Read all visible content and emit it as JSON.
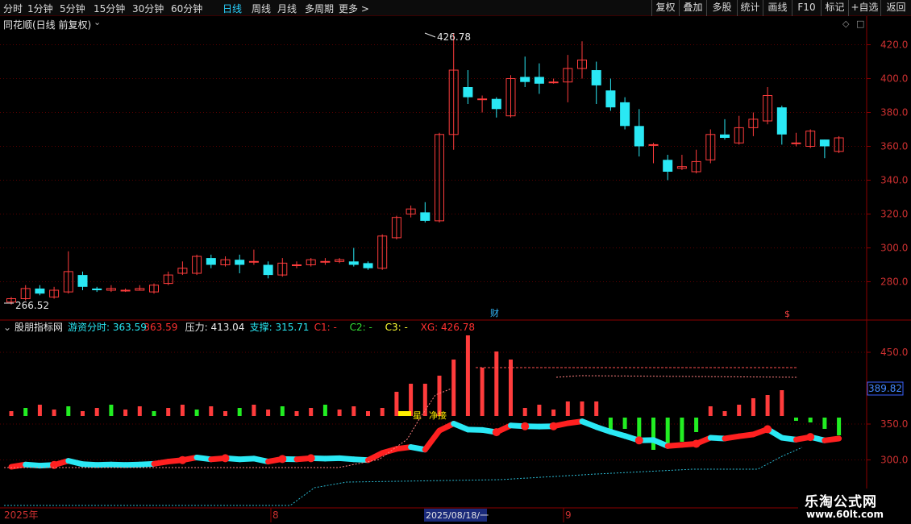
{
  "toolbar": {
    "periods": [
      "分时",
      "1分钟",
      "5分钟",
      "15分钟",
      "30分钟",
      "60分钟",
      "日线",
      "周线",
      "月线",
      "多周期",
      "更多 >"
    ],
    "active_period": "日线",
    "right_buttons": [
      "复权",
      "叠加",
      "多股",
      "统计",
      "画线",
      "F10",
      "标记",
      "+自选",
      "返回"
    ]
  },
  "main_chart": {
    "title": "同花顺(日线 前复权)",
    "y_ticks": [
      "420.0",
      "400.0",
      "380.0",
      "360.0",
      "340.0",
      "320.0",
      "300.0",
      "280.0"
    ],
    "high_label": "426.78",
    "low_label": "266.52",
    "event_marker_cai": "财",
    "event_marker_s": "$"
  },
  "indicator": {
    "name": "股朋指标网",
    "items": [
      {
        "label": "游资分时: 363.59",
        "color": "#2ae8f4"
      },
      {
        "label": "363.59",
        "color": "#ff3030"
      },
      {
        "label": "压力: 413.04",
        "color": "#e8e8e8"
      },
      {
        "label": "支撑: 315.71",
        "color": "#2ae8f4"
      },
      {
        "label": "C1: -",
        "color": "#ff3030"
      },
      {
        "label": "C2: -",
        "color": "#33dd33"
      },
      {
        "label": "C3: -",
        "color": "#ffff33"
      },
      {
        "label": "XG: 426.78",
        "color": "#ff3030"
      }
    ],
    "y_ticks": [
      "450.0",
      "350.0",
      "300.0"
    ],
    "price_box": "389.82",
    "annotation": "净接"
  },
  "timeline": {
    "labels": [
      "2025年",
      "8",
      "2025/08/18/一",
      "9"
    ]
  },
  "watermark": {
    "line1": "乐淘公式网",
    "line2": "www.60lt.com"
  },
  "colors": {
    "up": "#ff3c3c",
    "down": "#2ae8f4",
    "grid": "#5a0000",
    "axis": "#8b0000"
  },
  "chart_data": {
    "type": "candlestick",
    "candles": [
      [
        268,
        270,
        266.52,
        271
      ],
      [
        270,
        276,
        269,
        278
      ],
      [
        276,
        273,
        272,
        278
      ],
      [
        271,
        275,
        270,
        277
      ],
      [
        274,
        286,
        273,
        298
      ],
      [
        284,
        277,
        275,
        286
      ],
      [
        276,
        275,
        274,
        277
      ],
      [
        275,
        276,
        274,
        278
      ],
      [
        275,
        275,
        274,
        276
      ],
      [
        275,
        276,
        275,
        278
      ],
      [
        274,
        278,
        273,
        279
      ],
      [
        279,
        284,
        278,
        286
      ],
      [
        285,
        288,
        284,
        292
      ],
      [
        285,
        295,
        284,
        296
      ],
      [
        294,
        290,
        288,
        296
      ],
      [
        290,
        293,
        289,
        295
      ],
      [
        293,
        290,
        285,
        296
      ],
      [
        292,
        292,
        290,
        299
      ],
      [
        290,
        284,
        282,
        292
      ],
      [
        284,
        291,
        283,
        294
      ],
      [
        290,
        290,
        288,
        292
      ],
      [
        290,
        293,
        289,
        294
      ],
      [
        292,
        292,
        290,
        294
      ],
      [
        292,
        293,
        291,
        294
      ],
      [
        292,
        290,
        289,
        300
      ],
      [
        291,
        288,
        287,
        292
      ],
      [
        288,
        307,
        287,
        308
      ],
      [
        306,
        318,
        305,
        319
      ],
      [
        320,
        323,
        318,
        325
      ],
      [
        321,
        316,
        315,
        327
      ],
      [
        316,
        367,
        315,
        368
      ],
      [
        367,
        405,
        358,
        426.78
      ],
      [
        395,
        389,
        385,
        405
      ],
      [
        388,
        388,
        380,
        390
      ],
      [
        388,
        382,
        377,
        389
      ],
      [
        378,
        400,
        377,
        402
      ],
      [
        401,
        398,
        395,
        413
      ],
      [
        401,
        397,
        391,
        409
      ],
      [
        398,
        398,
        397,
        400
      ],
      [
        398,
        406,
        386,
        414
      ],
      [
        406,
        411,
        400,
        422
      ],
      [
        405,
        396,
        385,
        410
      ],
      [
        393,
        383,
        381,
        400
      ],
      [
        386,
        372,
        370,
        389
      ],
      [
        372,
        360,
        354,
        382
      ],
      [
        361,
        361,
        350,
        362
      ],
      [
        352,
        345,
        340,
        355
      ],
      [
        347,
        348,
        346,
        355
      ],
      [
        345,
        351,
        344,
        358
      ],
      [
        352,
        367,
        350,
        370
      ],
      [
        367,
        365,
        364,
        376
      ],
      [
        362,
        371,
        361,
        378
      ],
      [
        371,
        376,
        366,
        380
      ],
      [
        375,
        390,
        373,
        395
      ],
      [
        383,
        367,
        361,
        384
      ],
      [
        362,
        362,
        360,
        368
      ],
      [
        360,
        369,
        359,
        370
      ],
      [
        364,
        360,
        353,
        364
      ],
      [
        357,
        365,
        356,
        366
      ]
    ]
  }
}
